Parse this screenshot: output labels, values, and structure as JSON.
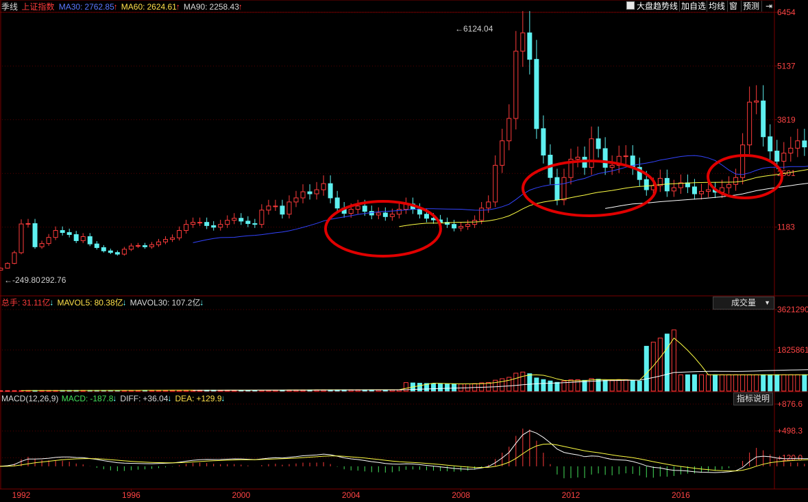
{
  "header": {
    "period": "季线",
    "index_name": "上证指数",
    "ma30": {
      "label": "MA30:",
      "value": "2762.85"
    },
    "ma60": {
      "label": "MA60:",
      "value": "2624.61"
    },
    "ma90": {
      "label": "MA90:",
      "value": "2258.43"
    }
  },
  "toolbar": {
    "market_trend_label": "大盘趋势线",
    "add_watch_label": "加自选",
    "ma_label": "均线",
    "window_label": "窗",
    "forecast_label": "预测",
    "expand_icon": "panel-toggle-icon"
  },
  "volume_header": {
    "total_label": "总手:",
    "total_value": "31.11亿",
    "mavol5_label": "MAVOL5:",
    "mavol5_value": "80.38亿",
    "mavol30_label": "MAVOL30:",
    "mavol30_value": "107.2亿",
    "selector_label": "成交量"
  },
  "macd_header": {
    "name": "MACD(12,26,9)",
    "macd_label": "MACD:",
    "macd_value": "-187.8",
    "diff_label": "DIFF:",
    "diff_value": "+36.04",
    "dea_label": "DEA:",
    "dea_value": "+129.9",
    "help_label": "指标说明"
  },
  "annotations": {
    "high_label": "6124.04",
    "low_label": "292.76",
    "low_overlap_label": "-249.80"
  },
  "colors": {
    "up": "#ff3b3b",
    "down": "#5ef0f0",
    "ma30": "#3344ff",
    "ma60": "#ffff44",
    "ma90": "#ffffff",
    "highlight_circle": "#e00000",
    "macd_neg": "#44e05a"
  },
  "chart_data": [
    {
      "type": "candlestick",
      "ylim": [
        0,
        6454
      ],
      "yticks": [
        "6454",
        "5137",
        "3819",
        "2501",
        "1183"
      ],
      "xticks": [
        "1992",
        "1996",
        "2000",
        "2004",
        "2008",
        "2012",
        "2016"
      ],
      "x_start": 1991.0,
      "step": 0.25,
      "series": [
        {
          "name": "MA30",
          "value": 2762.85
        },
        {
          "name": "MA60",
          "value": 2624.61
        },
        {
          "name": "MA90",
          "value": 2258.43
        }
      ],
      "high_point": 6124.04,
      "low_point": 292.76,
      "closes": [
        128,
        175,
        292,
        555,
        1260,
        1270,
        700,
        780,
        930,
        1100,
        1050,
        1000,
        850,
        950,
        770,
        680,
        600,
        560,
        520,
        640,
        720,
        730,
        700,
        750,
        820,
        880,
        920,
        1100,
        1250,
        1300,
        1300,
        1220,
        1180,
        1250,
        1350,
        1400,
        1330,
        1270,
        1250,
        1600,
        1700,
        1700,
        1500,
        1800,
        1900,
        2050,
        2000,
        2100,
        2250,
        1900,
        1650,
        1520,
        1620,
        1700,
        1570,
        1480,
        1530,
        1440,
        1500,
        1620,
        1750,
        1620,
        1500,
        1400,
        1360,
        1300,
        1250,
        1160,
        1200,
        1250,
        1350,
        1650,
        1800,
        2700,
        3300,
        3850,
        5500,
        5950,
        5300,
        3600,
        2950,
        2400,
        1850,
        2400,
        2850,
        2900,
        2650,
        3350,
        3110,
        2650,
        2700,
        2920,
        2930,
        2650,
        2350,
        2100,
        2200,
        2380,
        2070,
        2150,
        2270,
        2170,
        2000,
        2060,
        2100,
        2040,
        2150,
        2230,
        2400,
        3200,
        4250,
        4280,
        3400,
        3050,
        2800,
        3000,
        3120,
        3300,
        3150,
        3260,
        3400,
        3200,
        2850,
        2700,
        2790,
        2820,
        2600
      ]
    },
    {
      "type": "bar",
      "name": "成交量",
      "yticks": [
        "3621290",
        "1825861"
      ],
      "ylim": [
        0,
        3621290
      ],
      "series": [
        {
          "name": "MAVOL5",
          "value": "80.38亿"
        },
        {
          "name": "MAVOL30",
          "value": "107.2亿"
        }
      ]
    },
    {
      "type": "bar",
      "name": "MACD(12,26,9)",
      "yticks": [
        "+876.6",
        "+498.3",
        "+120.0"
      ],
      "macd": -187.8,
      "diff": 36.04,
      "dea": 129.9
    }
  ]
}
